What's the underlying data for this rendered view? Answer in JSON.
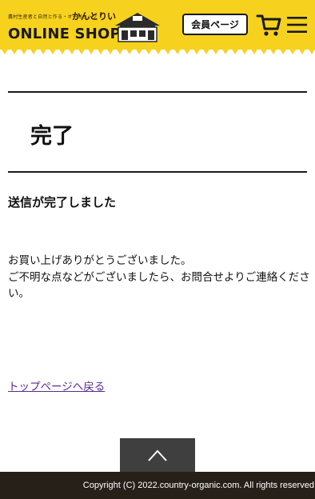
{
  "header": {
    "tagline": "農村生産者と自然と作る・オーガニック",
    "brand": "かんとりい",
    "shop_title": "ONLINE SHOP",
    "member_button": "会員ページ",
    "icons": [
      "cart-icon",
      "hamburger-menu-icon",
      "house-logo-icon"
    ],
    "accent_color": "#f6d21e"
  },
  "main": {
    "page_title": "完了",
    "subheading": "送信が完了しました",
    "message_lines": [
      "お買い上げありがとうございました。",
      "ご不明な点などがございましたら、お問合せよりご連絡ください。"
    ],
    "back_link": "トップページへ戻る"
  },
  "page_top_button": {
    "icon": "chevron-up-icon"
  },
  "footer": {
    "copyright": "Copyright  (C) 2022.country-organic.com. All rights reserved."
  }
}
